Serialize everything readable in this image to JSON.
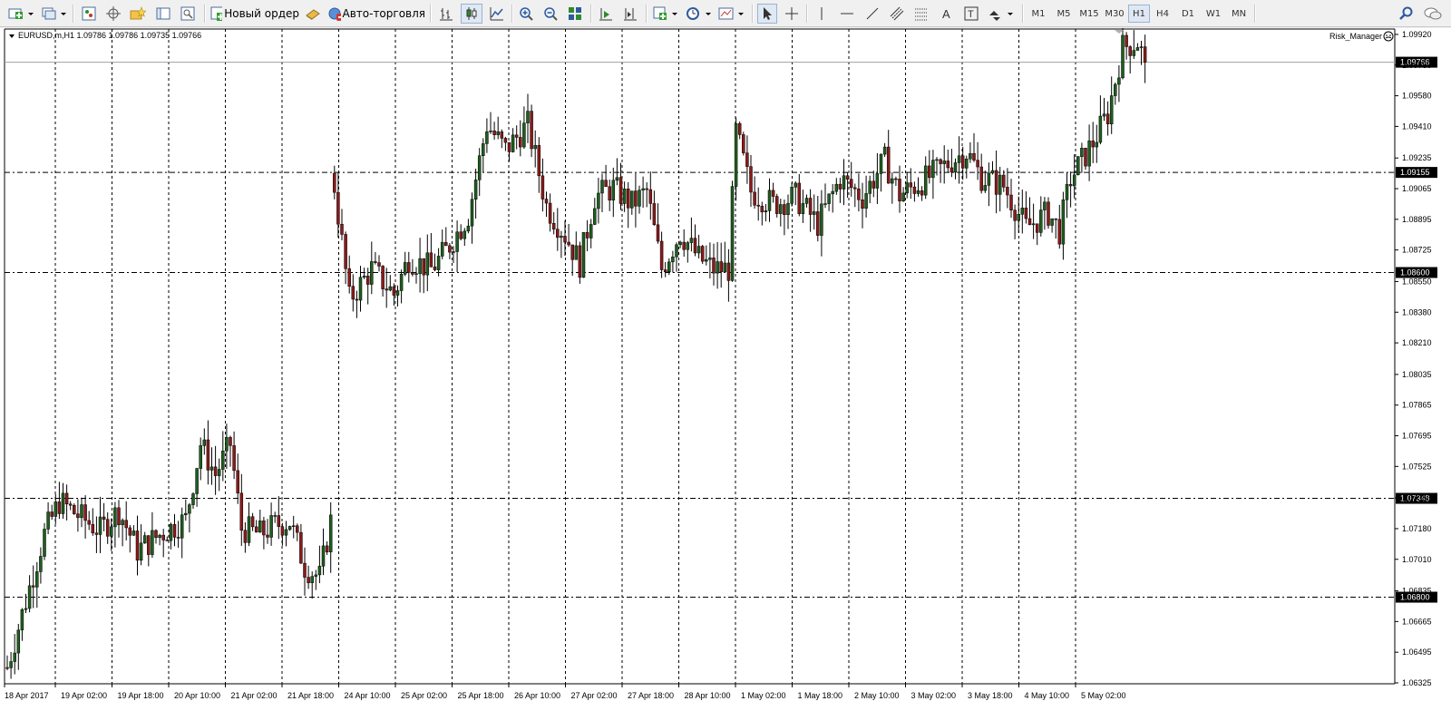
{
  "toolbar": {
    "new_order_label": "Новый ордер",
    "autotrading_label": "Авто-торговля",
    "timeframes": [
      "M1",
      "M5",
      "M15",
      "M30",
      "H1",
      "H4",
      "D1",
      "W1",
      "MN"
    ],
    "active_timeframe": "H1"
  },
  "chart": {
    "title": "EURUSD,m,H1  1.09786 1.09786 1.09735 1.09766",
    "expert_name": "Risk_Manager",
    "current_price": "1.09766",
    "colors": {
      "bull_body": "#1f5e1f",
      "bear_body": "#8b1a1a",
      "wick": "#000000",
      "price_label_bg": "#000000",
      "price_label_fg": "#ffffff",
      "background": "#ffffff"
    }
  },
  "chart_data": {
    "type": "candlestick",
    "symbol": "EURUSD,m",
    "timeframe": "H1",
    "ohlc_header": {
      "open": 1.09786,
      "high": 1.09786,
      "low": 1.09735,
      "close": 1.09766
    },
    "y_ticks": [
      "1.09920",
      "1.09750",
      "1.09580",
      "1.09410",
      "1.09235",
      "1.09065",
      "1.08895",
      "1.08725",
      "1.08550",
      "1.08380",
      "1.08210",
      "1.08035",
      "1.07865",
      "1.07695",
      "1.07525",
      "1.07350",
      "1.07180",
      "1.07010",
      "1.06835",
      "1.06665",
      "1.06495",
      "1.06325"
    ],
    "ylim": [
      1.0632,
      1.0995
    ],
    "x_ticks": [
      "18 Apr 2017",
      "19 Apr 02:00",
      "19 Apr 18:00",
      "20 Apr 10:00",
      "21 Apr 02:00",
      "21 Apr 18:00",
      "24 Apr 10:00",
      "25 Apr 02:00",
      "25 Apr 18:00",
      "26 Apr 10:00",
      "27 Apr 02:00",
      "27 Apr 18:00",
      "28 Apr 10:00",
      "1 May 02:00",
      "1 May 18:00",
      "2 May 10:00",
      "3 May 02:00",
      "3 May 18:00",
      "4 May 10:00",
      "5 May 02:00"
    ],
    "horizontal_levels": [
      {
        "price": "1.09155",
        "value": 1.09155
      },
      {
        "price": "1.08600",
        "value": 1.086
      },
      {
        "price": "1.07348",
        "value": 1.07348
      },
      {
        "price": "1.06800",
        "value": 1.068
      }
    ],
    "current_price": {
      "label": "1.09766",
      "value": 1.09766
    },
    "bars": 240,
    "start_value": 1.0641,
    "series_path": [
      {
        "bar": 0,
        "close": 1.0641
      },
      {
        "bar": 10,
        "close": 1.0715
      },
      {
        "bar": 14,
        "close": 1.0733
      },
      {
        "bar": 20,
        "close": 1.0724
      },
      {
        "bar": 25,
        "close": 1.0717
      },
      {
        "bar": 30,
        "close": 1.0728
      },
      {
        "bar": 35,
        "close": 1.0706
      },
      {
        "bar": 42,
        "close": 1.0716
      },
      {
        "bar": 48,
        "close": 1.0723
      },
      {
        "bar": 52,
        "close": 1.0765
      },
      {
        "bar": 56,
        "close": 1.0748
      },
      {
        "bar": 60,
        "close": 1.0765
      },
      {
        "bar": 63,
        "close": 1.0718
      },
      {
        "bar": 68,
        "close": 1.0715
      },
      {
        "bar": 72,
        "close": 1.072
      },
      {
        "bar": 76,
        "close": 1.0722
      },
      {
        "bar": 80,
        "close": 1.0697
      },
      {
        "bar": 84,
        "close": 1.0691
      },
      {
        "bar": 87,
        "close": 1.0722
      },
      {
        "bar": 88,
        "close": 1.0908
      },
      {
        "bar": 92,
        "close": 1.0845
      },
      {
        "bar": 98,
        "close": 1.0862
      },
      {
        "bar": 104,
        "close": 1.0848
      },
      {
        "bar": 108,
        "close": 1.0868
      },
      {
        "bar": 114,
        "close": 1.0862
      },
      {
        "bar": 118,
        "close": 1.0872
      },
      {
        "bar": 124,
        "close": 1.0892
      },
      {
        "bar": 129,
        "close": 1.0942
      },
      {
        "bar": 134,
        "close": 1.0928
      },
      {
        "bar": 140,
        "close": 1.0942
      },
      {
        "bar": 145,
        "close": 1.0897
      },
      {
        "bar": 150,
        "close": 1.0881
      },
      {
        "bar": 154,
        "close": 1.0865
      },
      {
        "bar": 158,
        "close": 1.0902
      },
      {
        "bar": 163,
        "close": 1.0907
      },
      {
        "bar": 168,
        "close": 1.0898
      },
      {
        "bar": 172,
        "close": 1.0905
      },
      {
        "bar": 176,
        "close": 1.0862
      },
      {
        "bar": 181,
        "close": 1.0882
      },
      {
        "bar": 186,
        "close": 1.0868
      },
      {
        "bar": 190,
        "close": 1.0862
      },
      {
        "bar": 194,
        "close": 1.0862
      },
      {
        "bar": 196,
        "close": 1.0938
      },
      {
        "bar": 200,
        "close": 1.0905
      },
      {
        "bar": 206,
        "close": 1.0898
      },
      {
        "bar": 212,
        "close": 1.0902
      },
      {
        "bar": 218,
        "close": 1.0887
      },
      {
        "bar": 224,
        "close": 1.0912
      },
      {
        "bar": 230,
        "close": 1.0902
      },
      {
        "bar": 236,
        "close": 1.0922
      },
      {
        "bar": 240,
        "close": 1.0903
      },
      {
        "bar": 248,
        "close": 1.0913
      },
      {
        "bar": 254,
        "close": 1.0922
      },
      {
        "bar": 258,
        "close": 1.0927
      },
      {
        "bar": 262,
        "close": 1.0913
      },
      {
        "bar": 268,
        "close": 1.0908
      },
      {
        "bar": 274,
        "close": 1.0885
      },
      {
        "bar": 280,
        "close": 1.0893
      },
      {
        "bar": 283,
        "close": 1.0883
      },
      {
        "bar": 286,
        "close": 1.0912
      },
      {
        "bar": 292,
        "close": 1.0932
      },
      {
        "bar": 296,
        "close": 1.0948
      },
      {
        "bar": 300,
        "close": 1.0985
      },
      {
        "bar": 304,
        "close": 1.0988
      },
      {
        "bar": 306,
        "close": 1.09766
      }
    ]
  }
}
